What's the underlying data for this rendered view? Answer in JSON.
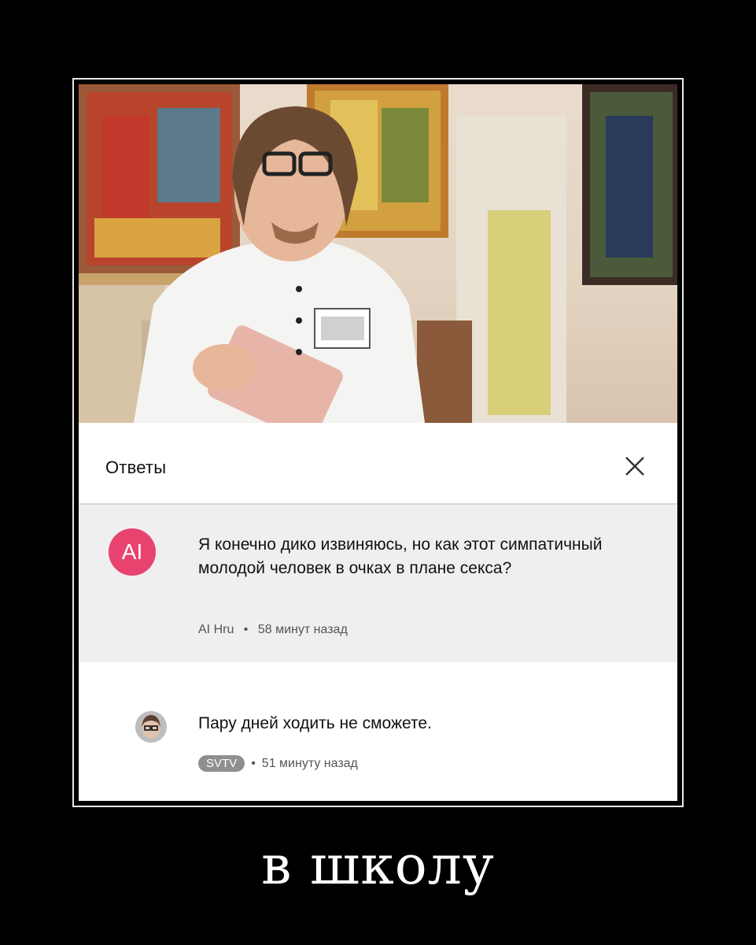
{
  "sheet": {
    "title": "Ответы"
  },
  "comment": {
    "avatar_text": "AI",
    "avatar_color": "#e8436e",
    "text": "Я конечно дико извиняюсь, но как этот симпатичный молодой человек в очках в плане секса?",
    "author": "AI Hru",
    "separator": "•",
    "time": "58 минут назад"
  },
  "reply": {
    "text": "Пару дней ходить не сможете.",
    "author_badge": "SVTV",
    "separator": "•",
    "time": "51 минуту назад"
  },
  "caption": "в школу",
  "icons": [
    "close-icon",
    "avatar-icon"
  ]
}
